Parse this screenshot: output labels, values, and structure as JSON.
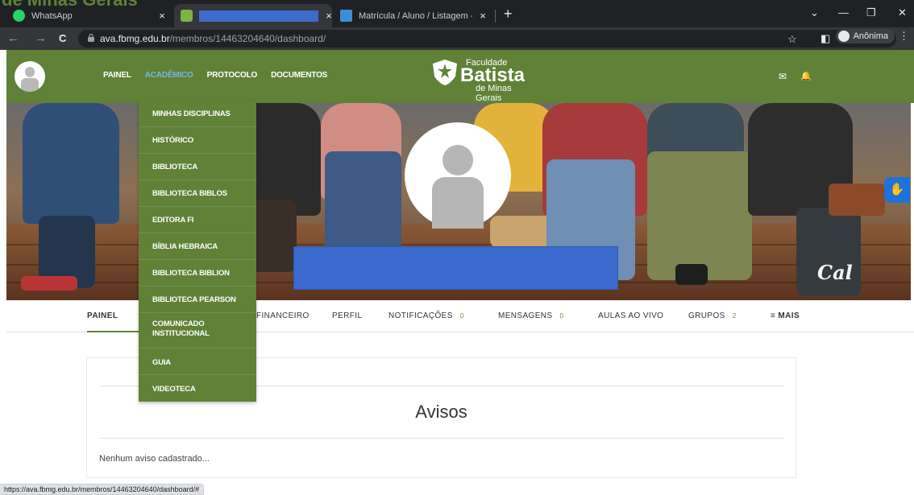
{
  "overlay_title": "de Minas Gerais",
  "browser": {
    "tabs": [
      {
        "title": "WhatsApp",
        "close": "×"
      },
      {
        "title": "",
        "close": "×"
      },
      {
        "title": "Matrícula / Aluno / Listagem - Si",
        "close": "×"
      }
    ],
    "new_tab": "+",
    "window_controls": {
      "min": "—",
      "max": "❐",
      "close": "✕",
      "tabsearch": "⌄"
    },
    "url_host": "ava.fbmg.edu.br",
    "url_path": "/membros/14463204640/dashboard/",
    "incognito_label": "Anônima",
    "back": "←",
    "forward": "→",
    "reload": "C",
    "star": "☆",
    "sidepanel": "◧",
    "menu": "⋮"
  },
  "header": {
    "nav": [
      "PAINEL",
      "ACADÊMICO",
      "PROTOCOLO",
      "DOCUMENTOS"
    ],
    "active_nav": "ACADÊMICO",
    "logo": {
      "line1": "Faculdade",
      "line2": "Batista",
      "line3": "de Minas Gerais"
    },
    "mail_icon": "✉",
    "bell_icon": "🔔"
  },
  "hero": {
    "decor_text": "Cal"
  },
  "subnav": {
    "painel": "PAINEL",
    "financeiro": "FINANCEIRO",
    "perfil": "PERFIL",
    "notificacoes": "NOTIFICAÇÕES",
    "notificacoes_count": "0",
    "mensagens": "MENSAGENS",
    "mensagens_count": "0",
    "aulas": "AULAS AO VIVO",
    "grupos": "GRUPOS",
    "grupos_count": "2",
    "mais": "≡ MAIS"
  },
  "dropdown": [
    "MINHAS DISCIPLINAS",
    "HISTÓRICO",
    "BIBLIOTECA",
    "BIBLIOTECA BIBLOS",
    "EDITORA FI",
    "BÍBLIA HEBRAICA",
    "BIBLIOTECA BIBLION",
    "BIBLIOTECA PEARSON",
    "COMUNICADO INSTITUCIONAL",
    "GUIA",
    "VIDEOTECA"
  ],
  "avisos": {
    "title": "Avisos",
    "empty": "Nenhum aviso cadastrado..."
  },
  "status_url": "https://ava.fbmg.edu.br/membros/14463204640/dashboard/#",
  "colors": {
    "brand_green": "#5f8237",
    "accent_blue": "#78b4e8",
    "redaction": "#3b6bcc"
  }
}
